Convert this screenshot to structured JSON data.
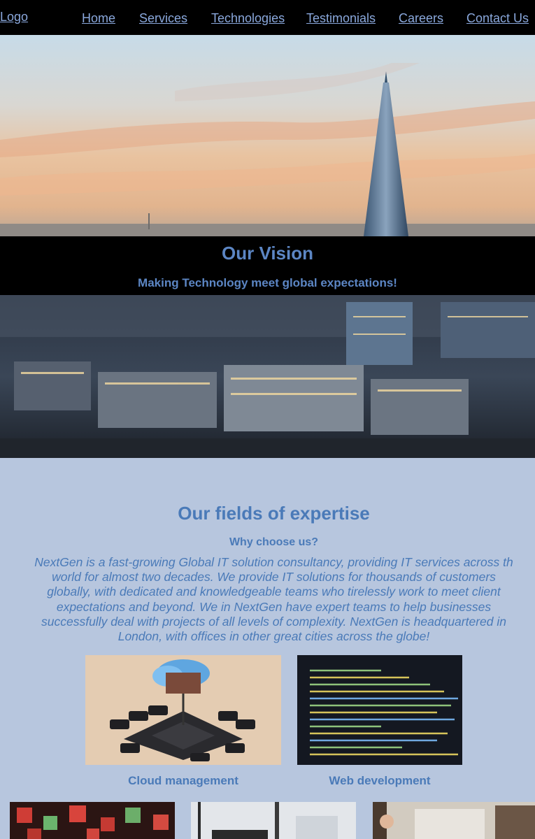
{
  "nav": {
    "logo": "Logo",
    "items": [
      "Home",
      "Services",
      "Technologies",
      "Testimonials",
      "Careers",
      "Contact Us"
    ]
  },
  "vision": {
    "title": "Our Vision",
    "subtitle": "Making Technology meet global expectations!"
  },
  "expertise": {
    "title": "Our fields of expertise",
    "subtitle": "Why choose us?",
    "paragraph": "NextGen is a fast-growing Global IT solution consultancy, providing IT services across th\nworld for almost two decades. We provide IT solutions for thousands of customers\nglobally, with dedicated and knowledgeable teams who tirelessly work to meet client\nexpectations and beyond. We in NextGen have expert teams to help businesses\nsuccessfully deal with projects of all levels of complexity. NextGen is headquartered in\nLondon, with offices in other great cities across the globe!",
    "cards": [
      {
        "label": "Cloud management"
      },
      {
        "label": "Web development"
      }
    ]
  },
  "colors": {
    "nav_bg": "#000000",
    "link": "#8aa8dc",
    "accent": "#4a7ab8",
    "page_bg": "#b7c6de"
  }
}
